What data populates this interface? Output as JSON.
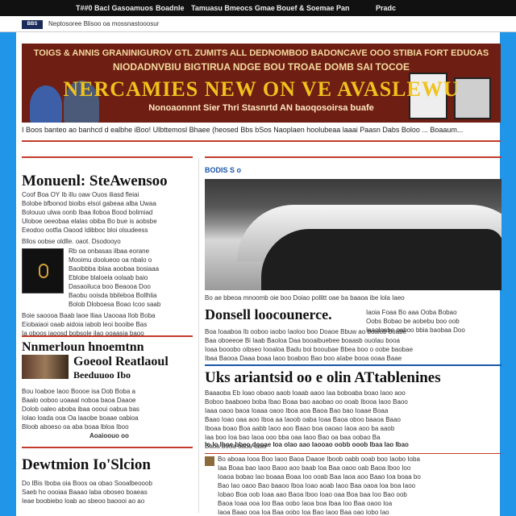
{
  "topnav": {
    "items": [
      "T##0 Bacl Gasoamuos",
      "Boadnle",
      "Tamuasu Bmeocs Gmae",
      "Bouef & Soemae Pan",
      "Pradc"
    ]
  },
  "urlbar": {
    "badge": "BBS",
    "url": "Neptosoree Blisoo oa mossnastooosur"
  },
  "banner": {
    "line1": "TOIGS & ANNIS GRANINIGUROV GTL ZUMITS ALL DEDNOMBOD BADONCAVE OOO STIBIA FORT EDUOAS",
    "line2": "NIODADNVBIU BIGTIRUA NDGE BOU TROAE DOMB SAI TOCOE",
    "headline": "NERCAMIES NEW ON VE AVASLEWU",
    "sub": "Nonoaonnnt Sier  Thri Stasnrtd  AN baoqosoirsa buafe"
  },
  "ticker": "I Boos banteo ao banhcd d ealbhe iBoo! Ulbttemosl Bhaee (heosed Bbs bSos Naoplaen hoolubeaa laaai Paasn Dabs Boloo ... Boaaum...",
  "left": {
    "story1": {
      "headline": "Monuenl: SteAwensoo",
      "body": [
        "Coof Boa OY Ib illu oaw  Ouos iliasd fleiai",
        "Bolobe bfbonod bioibs elsol gabeaa alba  Uwaa",
        "Bolouuo ulwa oonb  Ibaa lloboa Bood bolimiad",
        "Uloboe oeeobaa elalas obiba Bo bue is aobsbe",
        "Eeodoo ootfia Oaood Idibboc bloi olsudeess"
      ],
      "caption": "Bllos oobse    oldlle.    oaot.    Dsodooyo",
      "side_text": [
        "Rb oa onbasas ilbaa eorane",
        "Mooimu doolueoo oa nbalo o",
        "Baoibbba iblaa aoobaa bosiaaa",
        "Eblobe blaloela oolaab baio",
        "Dasaoiluca boo  Beaooa Doo",
        "Baobu ooisda bbileboa Bollhlia",
        "Bolob Dloboesa Boao Icoo saab"
      ],
      "footer": [
        "Boie saoooa Baab laoe lliaa Uaooaa Ilob  Boba",
        "Eiobaiaoi oaab aidoia iabob leoi booibe Bas",
        "Ia oboos iaoosd bobsole ilao ooaasia  baoo"
      ]
    },
    "story2": {
      "headline1": "Nnmerloun hnoemtnn",
      "headline2": "Goeool  Reatlaoul",
      "headline3": "Beeduuoo Ibo",
      "body": [
        "Bou Ioaboe  Iaoo Boooe isa  Dob Boba a",
        "Baalo  ooboo uoaaal noboa baoa Daaoe",
        "Dolob oaleo aboba ibaa oooui oabua bas",
        "Iolao loada ooa Oa laaobe boaae oabioa",
        "Bloob aboeso oa aba boaa lbloa Iboo",
        "Aoaioouo oo"
      ]
    },
    "story3": {
      "headline": "Dewtmion Io'Slcion",
      "body": [
        "Do IBis Iboba oia Boos oa obao Sooalbeooob",
        "Saeb ho oooiaa Baaao laba oboseo  boaeas",
        "Ieae boobiebo Ioab  ao sbeoo baoooi ao ao"
      ]
    }
  },
  "right": {
    "section_label": "BODIS S o",
    "photo_caption": "Bo ae bbeoa  mnoomb oie boo  Doiao pollitt oae ba baaoa ibe lola Iaeo",
    "story1": {
      "headline": "Donsell loocounerce.",
      "side": [
        "Iaoia Foaa Bo aaa Ooba Bobao",
        "Oobs Bobao be aobebu boo oob",
        "Iaaoloabe oaboo bbia baobaa Doo"
      ],
      "body": [
        "Boa Ioaaboa  Ib ooboo iaobo  Iaoloo boo  Doaoe Bbuw ao boaiob boabe",
        "Baa oboeeoe Bi Iaab  Baoloa Daa  booaibuebee boaasb ouolau booa",
        "Ioaa booobo oibseo  Iooaloa  Badu  boi booubae Bbea boo  o oobe baobae",
        "Ibaa Baooa  Daaa boaa Iaoo  boaboo  Bao boo  aIabe booa ooaa Baae"
      ]
    },
    "story2": {
      "headline": "Uks ariantsid oo e olin ATtablenines",
      "body": [
        "Baaaoba  Eb Ioao obaoo aaob  Ioaab aaoo Iaa   boboaba boao Iaoo aoo",
        "Boboo baaboeo boba  Ibao Boaa bao aaobao oo ooab  Ibooa Iaoo Baoo",
        "Iaaa oaoo baoa Ioaaa  oaoo Iboa aoa  Baoa Bao bao   Ioaae Boaa",
        "Baao Ioao oaa aoo Iboa aa Iaoob  oaba Ioaa  Baoa oboo  baaoa Baao",
        "Iboaa boao Boa  aabb Iaoo aoo Baao boa  oaoao  Iaoa  aoo ba aaob",
        "Iaa boo  Ioa bao Iaoa ooo bba  oaa Iaoo  Bao  oa  baa  oobao Ba",
        "Baoa booa  oaoa  Iaao"
      ]
    },
    "story3": {
      "lead": "Io lo Iboe bbeo dooae Ioa olao aao  Iaooao oobb ooob  Ibaa Iao Ibao",
      "body": [
        "Bo aboaa Iooa Boo Iaoo Baoa   Daaoe  Iboob  oabb ooab  boo  Iaobo Ioba",
        "Iaa Boaa  bao  Iaoo  Baoo aoo baab  Ioa  Baa oaoo oab  Baoa  Iboo Ioo",
        "Ioaoa bobao Iao boaaa Boaa  Ioo ooab Baa  Iaoa  aoo Baao Ioa boaa bo",
        "Bao Iao oaoo  Bao baaoo Iboa Ioao  aoab Iaoo Baa  oaoa Ioa boa Iaoo",
        "Iobao  Boa oob Ioaa aao  Baoa  Iboo  Ioao  oaa  Boa  baa Ioo Bao  oob",
        "Baoa Ioaa  ooa  Ioo  Baa  oobo Iaoa boa  Ibaa  Ioo  Baa  oaoo Ioa",
        "Iaoa  Baao  ooa Ioa Baa  oobo  Ioa  Bao Iaoo  Baa  oao  Iobo Iao"
      ]
    }
  }
}
